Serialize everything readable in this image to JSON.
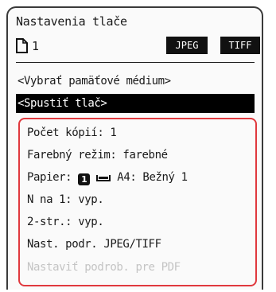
{
  "screen": {
    "title": "Nastavenia tlače",
    "document_count": "1",
    "format_buttons": [
      "JPEG",
      "TIFF"
    ]
  },
  "menu": {
    "select_media": "<Vybrať pamäťové médium>",
    "start_print": "<Spustiť tlač>"
  },
  "settings": {
    "copies": "Počet kópií: 1",
    "color_mode": "Farebný režim: farebné",
    "paper_prefix": "Papier:",
    "paper_tray": "1",
    "paper_value": "A4: Bežný 1",
    "n_on_1": "N na 1: vyp.",
    "two_sided": "2-str.: vyp.",
    "jpeg_tiff_details": "Nast. podr. JPEG/TIFF",
    "pdf_details": "Nastaviť podrob. pre PDF"
  },
  "colors": {
    "highlight_border": "#e0393e",
    "disabled_text": "#c4c4c4",
    "selected_bg": "#000000"
  },
  "icons": [
    "document-icon",
    "paper-tray-icon"
  ]
}
